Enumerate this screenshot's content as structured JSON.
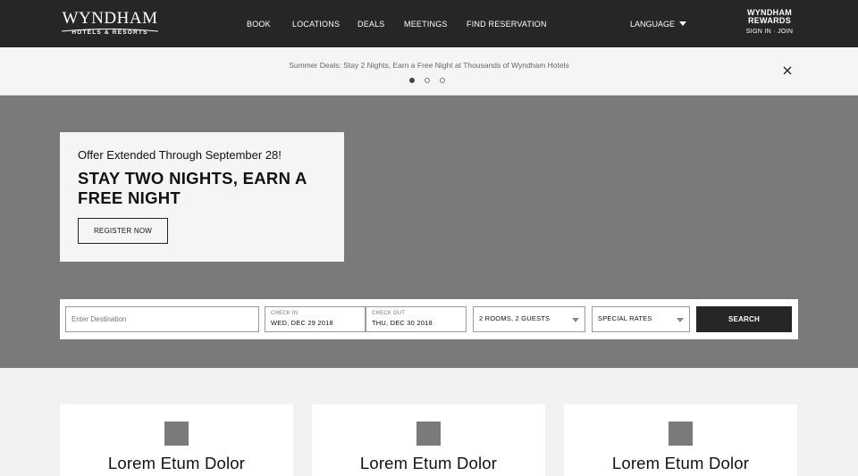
{
  "header": {
    "logo_main": "WYNDHAM",
    "logo_sub": "HOTELS & RESORTS",
    "nav": [
      "BOOK",
      "LOCATIONS",
      "DEALS",
      "MEETINGS",
      "FIND RESERVATION"
    ],
    "language_label": "LANGUAGE",
    "rewards_line1": "WYNDHAM",
    "rewards_line2": "REWARDS",
    "rewards_sep": "·",
    "sign_in": "SIGN IN",
    "join": "JOIN"
  },
  "promo": {
    "text": "Summer Deals: Stay 2 Nights, Earn a Free Night at Thousands of Wyndham Hotels",
    "slides_total": 3,
    "active_slide": 1
  },
  "hero": {
    "kicker": "Offer Extended Through September 28!",
    "title": "STAY TWO NIGHTS, EARN A FREE NIGHT",
    "cta": "REGISTER NOW"
  },
  "search": {
    "destination_placeholder": "Enter Destination",
    "checkin_label": "CHECK IN",
    "checkin_value": "WED, DEC 29 2018",
    "checkout_label": "CHECK OUT",
    "checkout_value": "THU, DEC 30 2018",
    "rooms_guests": "2 ROOMS, 2 GUESTS",
    "special_rates": "SPECIAL RATES",
    "search_label": "SEARCH"
  },
  "cards": [
    {
      "title": "Lorem Etum Dolor"
    },
    {
      "title": "Lorem Etum Dolor"
    },
    {
      "title": "Lorem Etum Dolor"
    }
  ],
  "colors": {
    "header_bg": "#262626",
    "hero_bg": "#7a7a7a",
    "page_bg": "#f2f2f2",
    "button_dark": "#262626"
  }
}
